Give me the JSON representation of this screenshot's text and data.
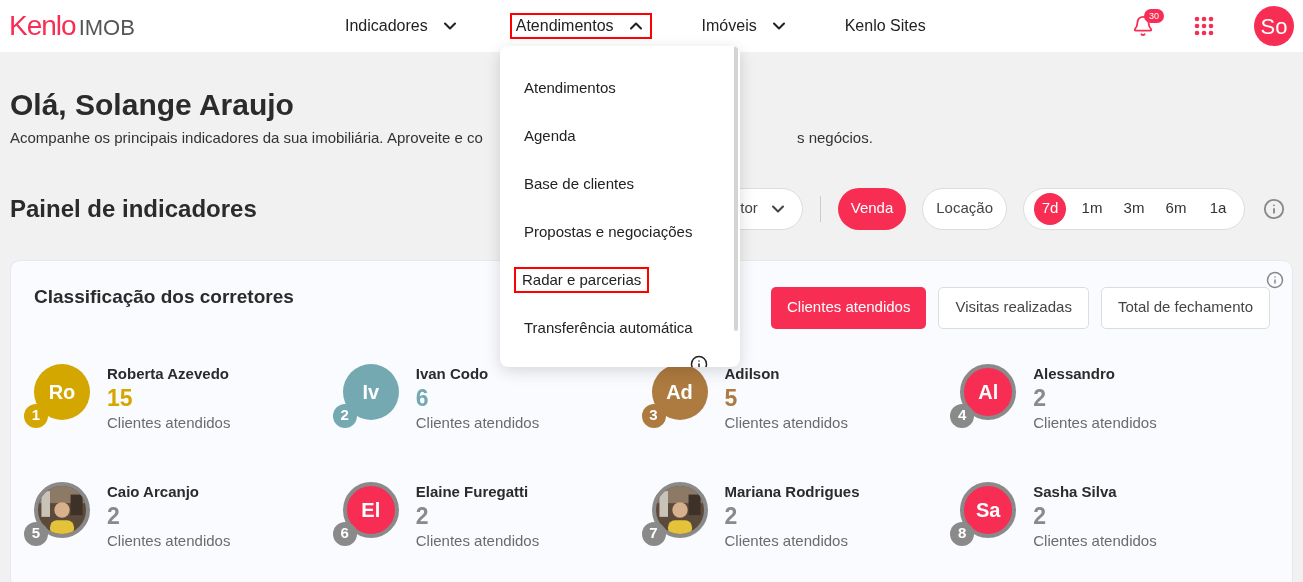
{
  "header": {
    "logo": {
      "brand": "Kenlo",
      "product": "IMOB"
    },
    "nav": [
      {
        "kind": "menu",
        "label": "Indicadores",
        "expanded": false,
        "highlighted": false
      },
      {
        "kind": "menu",
        "label": "Atendimentos",
        "expanded": true,
        "highlighted": true
      },
      {
        "kind": "menu",
        "label": "Imóveis",
        "expanded": false,
        "highlighted": false
      },
      {
        "kind": "link",
        "label": "Kenlo Sites",
        "highlighted": false
      }
    ],
    "notifications": "30",
    "avatar": "So"
  },
  "dropdown": {
    "items": [
      {
        "label": "Atendimentos",
        "highlighted": false
      },
      {
        "label": "Agenda",
        "highlighted": false
      },
      {
        "label": "Base de clientes",
        "highlighted": false
      },
      {
        "label": "Propostas e negociações",
        "highlighted": false
      },
      {
        "label": "Radar e parcerias",
        "highlighted": true
      },
      {
        "label": "Transferência automática",
        "highlighted": false
      }
    ]
  },
  "greeting": "Olá, Solange Araujo",
  "subtitle_parts": [
    "Acompanhe os principais indicadores da sua imobiliária. Aproveite e co",
    "s negócios."
  ],
  "panel": {
    "title": "Painel de indicadores",
    "filter_fragment": "tor",
    "modes": [
      {
        "label": "Venda",
        "selected": true
      },
      {
        "label": "Locação",
        "selected": false
      }
    ],
    "periods": [
      {
        "label": "7d",
        "selected": true
      },
      {
        "label": "1m",
        "selected": false
      },
      {
        "label": "3m",
        "selected": false
      },
      {
        "label": "6m",
        "selected": false
      },
      {
        "label": "1a",
        "selected": false
      }
    ]
  },
  "ranking": {
    "title": "Classificação dos corretores",
    "tabs": [
      {
        "label": "Clientes atendidos",
        "selected": true
      },
      {
        "label": "Visitas realizadas",
        "selected": false
      },
      {
        "label": "Total de fechamento",
        "selected": false
      }
    ],
    "brokers": [
      {
        "rank": "1",
        "name": "Roberta Azevedo",
        "value": "15",
        "caption": "Clientes atendidos",
        "kind": "initials",
        "initials": "Ro",
        "ringed": false,
        "color": "#d4a600"
      },
      {
        "rank": "2",
        "name": "Ivan Codo",
        "value": "6",
        "caption": "Clientes atendidos",
        "kind": "initials",
        "initials": "Iv",
        "ringed": false,
        "color": "#74a9b2"
      },
      {
        "rank": "3",
        "name": "Adilson",
        "value": "5",
        "caption": "Clientes atendidos",
        "kind": "initials",
        "initials": "Ad",
        "ringed": false,
        "color": "#ad7a3f"
      },
      {
        "rank": "4",
        "name": "Alessandro",
        "value": "2",
        "caption": "Clientes atendidos",
        "kind": "initials",
        "initials": "Al",
        "ringed": true,
        "color": "#8a8a8a"
      },
      {
        "rank": "5",
        "name": "Caio Arcanjo",
        "value": "2",
        "caption": "Clientes atendidos",
        "kind": "picture",
        "ringed": true,
        "color": "#8a8a8a"
      },
      {
        "rank": "6",
        "name": "Elaine Furegatti",
        "value": "2",
        "caption": "Clientes atendidos",
        "kind": "initials",
        "initials": "El",
        "ringed": true,
        "color": "#8a8a8a"
      },
      {
        "rank": "7",
        "name": "Mariana Rodrigues",
        "value": "2",
        "caption": "Clientes atendidos",
        "kind": "picture",
        "ringed": true,
        "color": "#8a8a8a"
      },
      {
        "rank": "8",
        "name": "Sasha Silva",
        "value": "2",
        "caption": "Clientes atendidos",
        "kind": "initials",
        "initials": "Sa",
        "ringed": true,
        "color": "#8a8a8a"
      }
    ]
  }
}
